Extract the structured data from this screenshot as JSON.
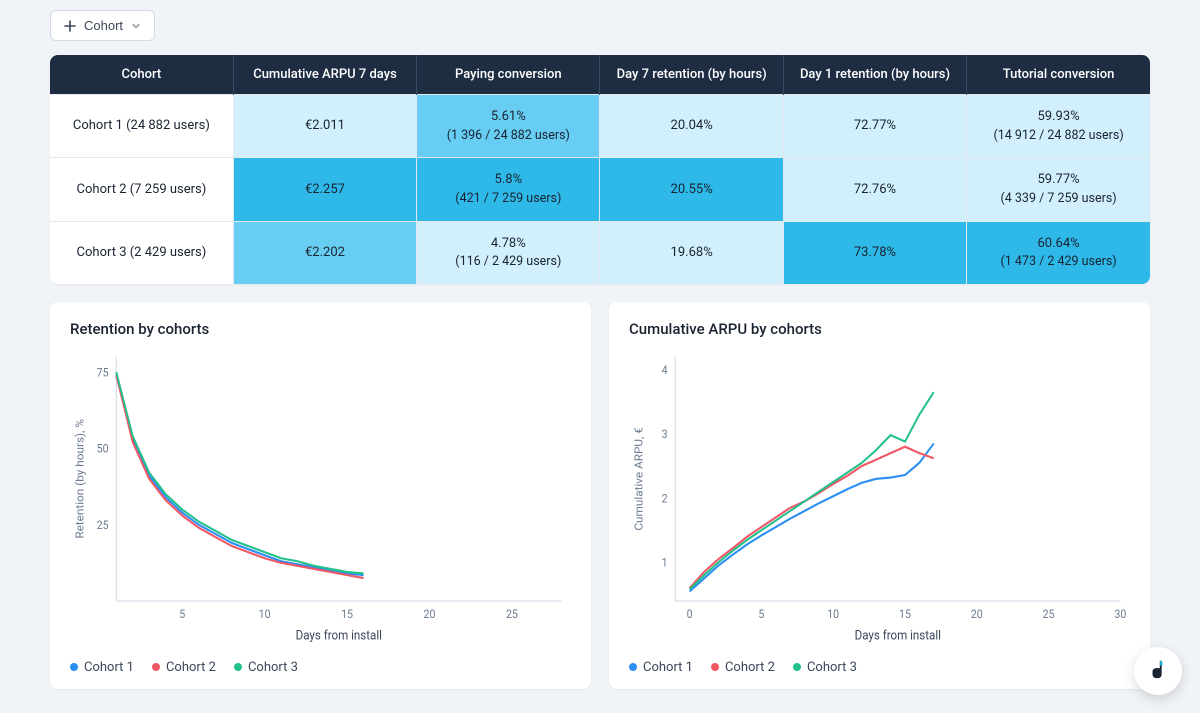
{
  "toolbar": {
    "cohort_label": "Cohort"
  },
  "colors": {
    "series1": "#2b8ef4",
    "series2": "#f25764",
    "series3": "#22c08b"
  },
  "table": {
    "headers": [
      "Cohort",
      "Cumulative ARPU 7 days",
      "Paying conversion",
      "Day 7 retention (by hours)",
      "Day 1 retention (by hours)",
      "Tutorial conversion"
    ],
    "rows": [
      {
        "cells": [
          {
            "v": "Cohort 1 (24 882 users)",
            "shade": "c-white"
          },
          {
            "v": "€2.011",
            "shade": "c-light"
          },
          {
            "v": "5.61%",
            "sub": "(1 396 / 24 882 users)",
            "shade": "c-mid"
          },
          {
            "v": "20.04%",
            "shade": "c-light"
          },
          {
            "v": "72.77%",
            "shade": "c-light"
          },
          {
            "v": "59.93%",
            "sub": "(14 912 / 24 882 users)",
            "shade": "c-light"
          }
        ]
      },
      {
        "cells": [
          {
            "v": "Cohort 2 (7 259 users)",
            "shade": "c-white"
          },
          {
            "v": "€2.257",
            "shade": "c-dark"
          },
          {
            "v": "5.8%",
            "sub": "(421 / 7 259 users)",
            "shade": "c-dark"
          },
          {
            "v": "20.55%",
            "shade": "c-dark"
          },
          {
            "v": "72.76%",
            "shade": "c-light"
          },
          {
            "v": "59.77%",
            "sub": "(4 339 / 7 259 users)",
            "shade": "c-light"
          }
        ]
      },
      {
        "cells": [
          {
            "v": "Cohort 3 (2 429 users)",
            "shade": "c-white"
          },
          {
            "v": "€2.202",
            "shade": "c-mid"
          },
          {
            "v": "4.78%",
            "sub": "(116 / 2 429 users)",
            "shade": "c-light"
          },
          {
            "v": "19.68%",
            "shade": "c-light"
          },
          {
            "v": "73.78%",
            "shade": "c-dark"
          },
          {
            "v": "60.64%",
            "sub": "(1 473 / 2 429 users)",
            "shade": "c-dark"
          }
        ]
      }
    ]
  },
  "chart1": {
    "title": "Retention by cohorts",
    "xlabel": "Days from install",
    "ylabel": "Retention (by hours), %",
    "legend": [
      "Cohort 1",
      "Cohort 2",
      "Cohort 3"
    ]
  },
  "chart2": {
    "title": "Cumulative ARPU by cohorts",
    "xlabel": "Days from install",
    "ylabel": "Cumulative ARPU, €",
    "legend": [
      "Cohort 1",
      "Cohort 2",
      "Cohort 3"
    ]
  },
  "chart_data": [
    {
      "type": "line",
      "title": "Retention by cohorts",
      "xlabel": "Days from install",
      "ylabel": "Retention (by hours), %",
      "x_ticks": [
        5,
        10,
        15,
        20,
        25
      ],
      "y_ticks": [
        25,
        50,
        75
      ],
      "xlim": [
        1,
        28
      ],
      "ylim": [
        0,
        80
      ],
      "series": [
        {
          "name": "Cohort 1",
          "color": "#2b8ef4",
          "x": [
            1,
            2,
            3,
            4,
            5,
            6,
            7,
            8,
            9,
            10,
            11,
            12,
            13,
            14,
            15,
            16
          ],
          "values": [
            74,
            53,
            41,
            34,
            29,
            25,
            22,
            19,
            17,
            15,
            13,
            12,
            11,
            10,
            9,
            8.5
          ]
        },
        {
          "name": "Cohort 2",
          "color": "#f25764",
          "x": [
            1,
            2,
            3,
            4,
            5,
            6,
            7,
            8,
            9,
            10,
            11,
            12,
            13,
            14,
            15,
            16
          ],
          "values": [
            74,
            52,
            40,
            33,
            28,
            24,
            21,
            18,
            16,
            14,
            12.5,
            11.5,
            10.5,
            9.5,
            8.5,
            7.5
          ]
        },
        {
          "name": "Cohort 3",
          "color": "#22c08b",
          "x": [
            1,
            2,
            3,
            4,
            5,
            6,
            7,
            8,
            9,
            10,
            11,
            12,
            13,
            14,
            15,
            16
          ],
          "values": [
            75,
            54,
            42,
            35,
            30,
            26,
            23,
            20,
            18,
            16,
            14,
            13,
            11.5,
            10.5,
            9.5,
            9
          ]
        }
      ]
    },
    {
      "type": "line",
      "title": "Cumulative ARPU by cohorts",
      "xlabel": "Days from install",
      "ylabel": "Cumulative ARPU, €",
      "x_ticks": [
        0,
        5,
        10,
        15,
        20,
        25,
        30
      ],
      "y_ticks": [
        1,
        2,
        3,
        4
      ],
      "xlim": [
        -1,
        30
      ],
      "ylim": [
        0.4,
        4.2
      ],
      "series": [
        {
          "name": "Cohort 1",
          "color": "#2b8ef4",
          "x": [
            0,
            1,
            2,
            3,
            4,
            5,
            6,
            7,
            8,
            9,
            10,
            11,
            12,
            13,
            14,
            15,
            16,
            17
          ],
          "values": [
            0.55,
            0.75,
            0.95,
            1.12,
            1.28,
            1.42,
            1.55,
            1.68,
            1.8,
            1.92,
            2.03,
            2.14,
            2.24,
            2.3,
            2.32,
            2.36,
            2.55,
            2.85
          ]
        },
        {
          "name": "Cohort 2",
          "color": "#f25764",
          "x": [
            0,
            1,
            2,
            3,
            4,
            5,
            6,
            7,
            8,
            9,
            10,
            11,
            12,
            13,
            14,
            15,
            16,
            17
          ],
          "values": [
            0.6,
            0.85,
            1.05,
            1.22,
            1.4,
            1.55,
            1.7,
            1.85,
            1.95,
            2.08,
            2.22,
            2.35,
            2.5,
            2.6,
            2.7,
            2.8,
            2.7,
            2.62
          ]
        },
        {
          "name": "Cohort 3",
          "color": "#22c08b",
          "x": [
            0,
            1,
            2,
            3,
            4,
            5,
            6,
            7,
            8,
            9,
            10,
            11,
            12,
            13,
            14,
            15,
            16,
            17
          ],
          "values": [
            0.58,
            0.8,
            1.0,
            1.18,
            1.35,
            1.5,
            1.65,
            1.8,
            1.95,
            2.1,
            2.25,
            2.4,
            2.55,
            2.75,
            2.98,
            2.88,
            3.3,
            3.65
          ]
        }
      ]
    }
  ]
}
